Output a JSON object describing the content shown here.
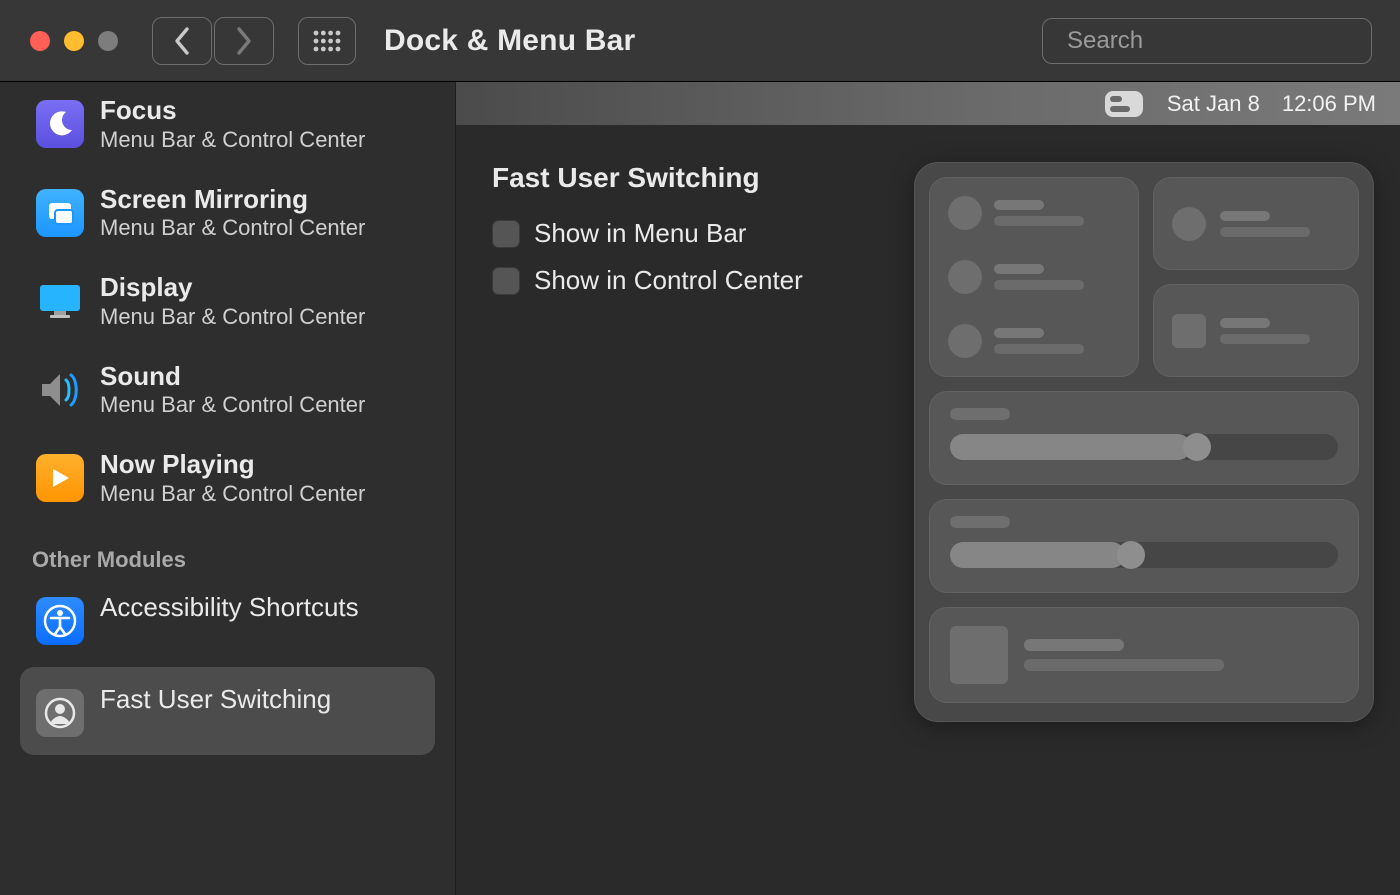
{
  "toolbar": {
    "title": "Dock & Menu Bar",
    "search_placeholder": "Search"
  },
  "sidebar": {
    "items": [
      {
        "title": "Focus",
        "subtitle": "Menu Bar & Control Center"
      },
      {
        "title": "Screen Mirroring",
        "subtitle": "Menu Bar & Control Center"
      },
      {
        "title": "Display",
        "subtitle": "Menu Bar & Control Center"
      },
      {
        "title": "Sound",
        "subtitle": "Menu Bar & Control Center"
      },
      {
        "title": "Now Playing",
        "subtitle": "Menu Bar & Control Center"
      }
    ],
    "section_label": "Other Modules",
    "other": [
      {
        "title": "Accessibility Shortcuts"
      },
      {
        "title": "Fast User Switching"
      }
    ],
    "selected": "Fast User Switching"
  },
  "menubar_preview": {
    "date": "Sat Jan 8",
    "time": "12:06 PM"
  },
  "main": {
    "heading": "Fast User Switching",
    "options": [
      {
        "label": "Show in Menu Bar",
        "checked": false
      },
      {
        "label": "Show in Control Center",
        "checked": false
      }
    ]
  },
  "colors": {
    "purple": "#5b4fe0",
    "blue": "#1c96ff",
    "orange": "#ff9500",
    "grey": "#6e6e6e"
  }
}
